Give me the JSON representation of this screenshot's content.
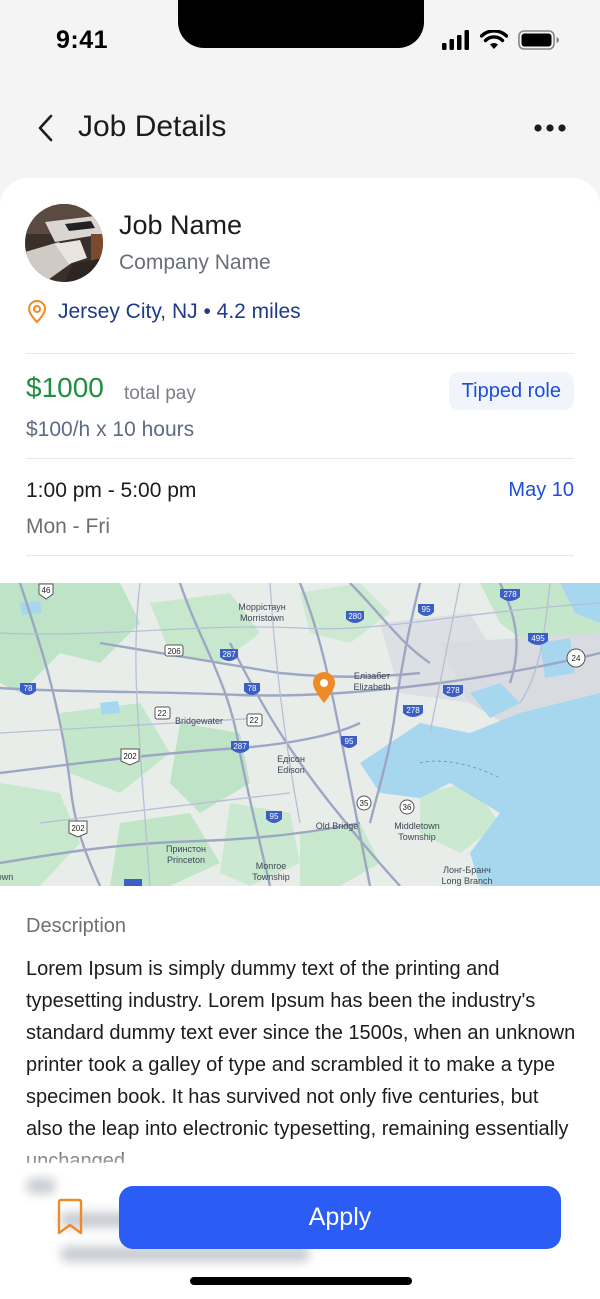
{
  "status_bar": {
    "time": "9:41"
  },
  "header": {
    "title": "Job Details"
  },
  "job": {
    "name": "Job Name",
    "company": "Company Name",
    "location": "Jersey City, NJ • 4.2 miles"
  },
  "pay": {
    "amount": "$1000",
    "label": "total pay",
    "rate": "$100/h x 10 hours",
    "badge": "Tipped role"
  },
  "schedule": {
    "time_range": "1:00 pm - 5:00 pm",
    "date": "May 10",
    "days": "Mon - Fri"
  },
  "map": {
    "labels": {
      "morristown_ru": "Моррістаун",
      "morristown": "Morristown",
      "elizabeth_ru": "Елізабет",
      "elizabeth": "Elizabeth",
      "bridgewater": "Bridgewater",
      "edison_ru": "Едісон",
      "edison": "Edison",
      "old_bridge": "Old Bridge",
      "middletown": "Middletown",
      "township": "Township",
      "princeton_ru": "Принстон",
      "princeton": "Princeton",
      "monroe": "Monroe",
      "monroe_township": "Township",
      "long_branch_ru": "Лонг-Бранч",
      "long_branch": "Long Branch",
      "town_fragment": "own"
    },
    "shields": {
      "r46": "46",
      "r206": "206",
      "r287a": "287",
      "r280": "280",
      "r95a": "95",
      "r278": "278",
      "r495": "495",
      "r24": "24",
      "r78a": "78",
      "r78b": "78",
      "r22a": "22",
      "r22b": "22",
      "r278b": "278",
      "r278c": "278",
      "r202a": "202",
      "r287b": "287",
      "r95b": "95",
      "r35": "35",
      "r36": "36",
      "r95c": "95",
      "r202b": "202"
    }
  },
  "description": {
    "heading": "Description",
    "body": "Lorem Ipsum is simply dummy text of the printing and typesetting industry. Lorem Ipsum has been the industry's standard dummy text ever since the 1500s, when an unknown printer took a galley of type and scrambled it to make a type specimen book. It has survived not only five centuries, but also the leap into electronic typesetting, remaining essentially unchanged."
  },
  "actions": {
    "apply_label": "Apply"
  },
  "colors": {
    "primary": "#2b5cf6",
    "pay_green": "#1e8f3e",
    "link_blue": "#1d4ed8",
    "location_blue": "#1e3a8a",
    "accent_orange": "#f08a24"
  },
  "icons": {
    "back": "chevron-left-icon",
    "more": "more-horizontal-icon",
    "location": "location-pin-icon",
    "bookmark": "bookmark-icon",
    "map_marker": "map-marker-icon"
  }
}
